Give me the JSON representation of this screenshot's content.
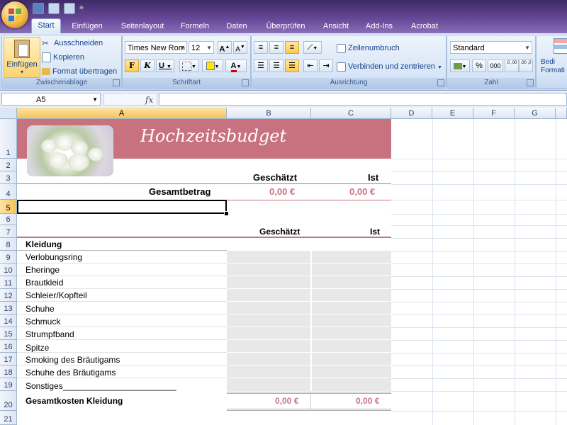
{
  "app": {
    "qat_separator": "≡"
  },
  "tabs": [
    "Start",
    "Einfügen",
    "Seitenlayout",
    "Formeln",
    "Daten",
    "Überprüfen",
    "Ansicht",
    "Add-Ins",
    "Acrobat"
  ],
  "active_tab": "Start",
  "ribbon": {
    "clipboard": {
      "label": "Zwischenablage",
      "paste": "Einfügen",
      "cut": "Ausschneiden",
      "copy": "Kopieren",
      "format_painter": "Format übertragen"
    },
    "font": {
      "label": "Schriftart",
      "font_name": "Times New Rom",
      "font_size": "12",
      "bold": "F",
      "italic": "K",
      "underline": "U",
      "grow": "A",
      "shrink": "A",
      "font_color_letter": "A"
    },
    "alignment": {
      "label": "Ausrichtung",
      "wrap_text": "Zeilenumbruch",
      "merge_center": "Verbinden und zentrieren"
    },
    "number": {
      "label": "Zahl",
      "format": "Standard",
      "percent": "%",
      "thousands": "000",
      "inc_decimal": ",0 ,00",
      "dec_decimal": ",00 ,0"
    },
    "styles": {
      "partial_label": "Bedi Formati"
    }
  },
  "formula_bar": {
    "name_box": "A5",
    "fx": "fx",
    "value": ""
  },
  "columns": [
    "A",
    "B",
    "C",
    "D",
    "E",
    "F",
    "G"
  ],
  "rows": [
    "1",
    "2",
    "3",
    "4",
    "5",
    "6",
    "7",
    "8",
    "9",
    "10",
    "11",
    "12",
    "13",
    "14",
    "15",
    "16",
    "17",
    "18",
    "19",
    "20",
    "21"
  ],
  "sheet": {
    "title": "Hochzeitsbudget",
    "estimated_header": "Geschätzt",
    "actual_header": "Ist",
    "total_label": "Gesamtbetrag",
    "total_estimated": "0,00 €",
    "total_actual": "0,00 €",
    "section": {
      "estimated_header": "Geschätzt",
      "actual_header": "Ist",
      "name": "Kleidung",
      "items": [
        "Verlobungsring",
        "Eheringe",
        "Brautkleid",
        "Schleier/Kopfteil",
        "Schuhe",
        "Schmuck",
        "Strumpfband",
        "Spitze",
        "Smoking des Bräutigams",
        "Schuhe des Bräutigams",
        "Sonstiges________________________"
      ],
      "total_label": "Gesamtkosten Kleidung",
      "total_estimated": "0,00 €",
      "total_actual": "0,00 €"
    }
  },
  "colors": {
    "accent": "#c9727f",
    "input_cell": "#e8e8e8",
    "ribbon_text": "#15428b"
  }
}
